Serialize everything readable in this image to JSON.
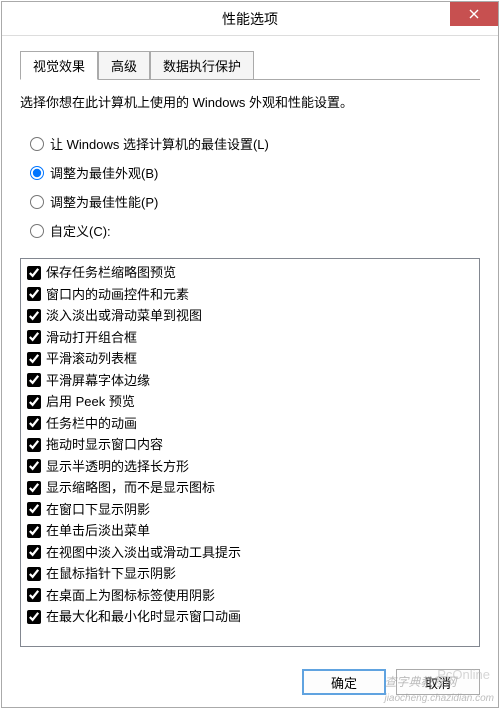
{
  "window": {
    "title": "性能选项"
  },
  "tabs": [
    {
      "label": "视觉效果",
      "active": true
    },
    {
      "label": "高级",
      "active": false
    },
    {
      "label": "数据执行保护",
      "active": false
    }
  ],
  "description": "选择你想在此计算机上使用的 Windows 外观和性能设置。",
  "radios": [
    {
      "label": "让 Windows 选择计算机的最佳设置(L)",
      "checked": false
    },
    {
      "label": "调整为最佳外观(B)",
      "checked": true
    },
    {
      "label": "调整为最佳性能(P)",
      "checked": false
    },
    {
      "label": "自定义(C):",
      "checked": false
    }
  ],
  "checkboxes": [
    {
      "label": "保存任务栏缩略图预览",
      "checked": true
    },
    {
      "label": "窗口内的动画控件和元素",
      "checked": true
    },
    {
      "label": "淡入淡出或滑动菜单到视图",
      "checked": true
    },
    {
      "label": "滑动打开组合框",
      "checked": true
    },
    {
      "label": "平滑滚动列表框",
      "checked": true
    },
    {
      "label": "平滑屏幕字体边缘",
      "checked": true
    },
    {
      "label": "启用 Peek 预览",
      "checked": true
    },
    {
      "label": "任务栏中的动画",
      "checked": true
    },
    {
      "label": "拖动时显示窗口内容",
      "checked": true
    },
    {
      "label": "显示半透明的选择长方形",
      "checked": true
    },
    {
      "label": "显示缩略图，而不是显示图标",
      "checked": true
    },
    {
      "label": "在窗口下显示阴影",
      "checked": true
    },
    {
      "label": "在单击后淡出菜单",
      "checked": true
    },
    {
      "label": "在视图中淡入淡出或滑动工具提示",
      "checked": true
    },
    {
      "label": "在鼠标指针下显示阴影",
      "checked": true
    },
    {
      "label": "在桌面上为图标标签使用阴影",
      "checked": true
    },
    {
      "label": "在最大化和最小化时显示窗口动画",
      "checked": true
    }
  ],
  "buttons": {
    "ok": "确定",
    "cancel": "取消"
  },
  "watermark": {
    "brand": "PcOnline",
    "site": "查字典教程网",
    "domain": "jiaocheng.chazidian.com"
  }
}
